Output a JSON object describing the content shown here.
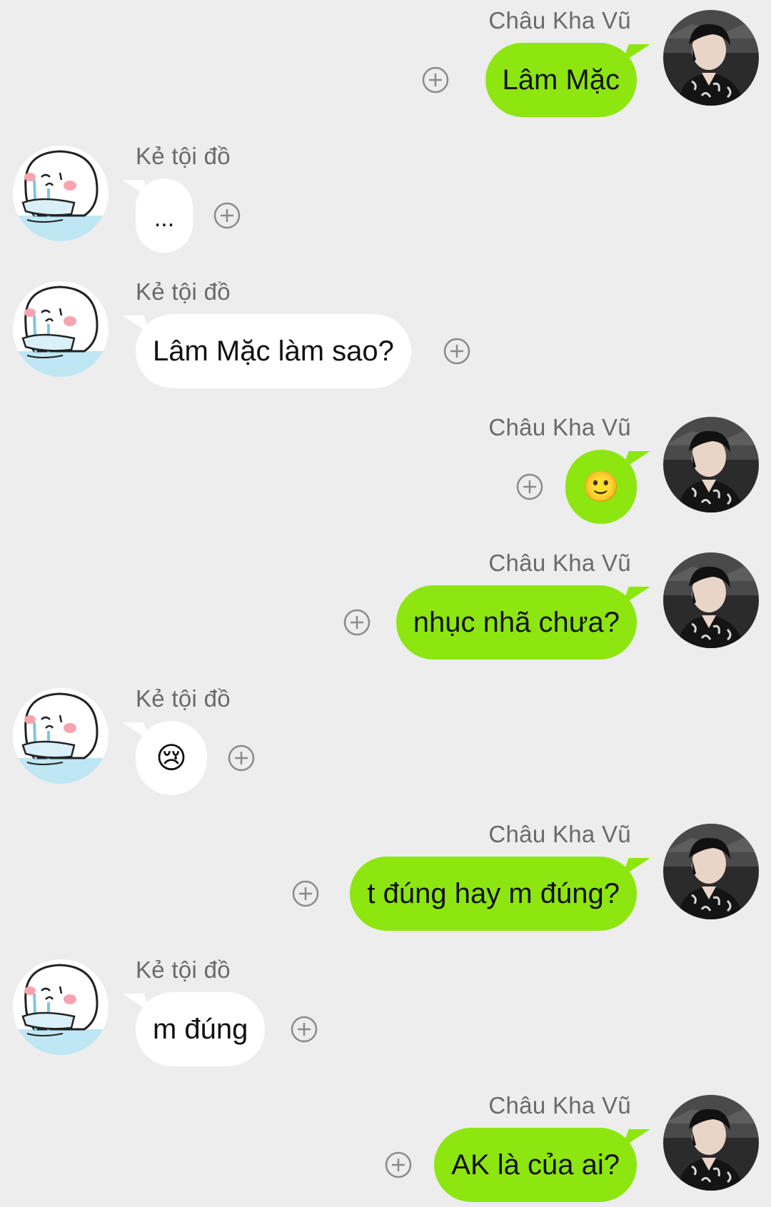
{
  "colors": {
    "background": "#ededed",
    "outgoing_bubble": "#8de60f",
    "incoming_bubble": "#ffffff",
    "sender_name": "#6a6a6a"
  },
  "messages": [
    {
      "direction": "out",
      "sender": "Châu Kha Vũ",
      "text": "Lâm Mặc",
      "avatar": "boy-portrait-avatar"
    },
    {
      "direction": "in",
      "sender": "Kẻ tội đồ",
      "text": "...",
      "avatar": "crying-cartoon-avatar"
    },
    {
      "direction": "in",
      "sender": "Kẻ tội đồ",
      "text": "Lâm Mặc làm sao?",
      "avatar": "crying-cartoon-avatar"
    },
    {
      "direction": "out",
      "sender": "Châu Kha Vũ",
      "text": "🙂",
      "avatar": "boy-portrait-avatar"
    },
    {
      "direction": "out",
      "sender": "Châu Kha Vũ",
      "text": "nhục nhã chưa?",
      "avatar": "boy-portrait-avatar"
    },
    {
      "direction": "in",
      "sender": "Kẻ tội đồ",
      "text": "😢",
      "avatar": "crying-cartoon-avatar"
    },
    {
      "direction": "out",
      "sender": "Châu Kha Vũ",
      "text": "t đúng hay m đúng?",
      "avatar": "boy-portrait-avatar"
    },
    {
      "direction": "in",
      "sender": "Kẻ tội đồ",
      "text": "m đúng",
      "avatar": "crying-cartoon-avatar"
    },
    {
      "direction": "out",
      "sender": "Châu Kha Vũ",
      "text": "AK là của ai?",
      "avatar": "boy-portrait-avatar"
    }
  ]
}
